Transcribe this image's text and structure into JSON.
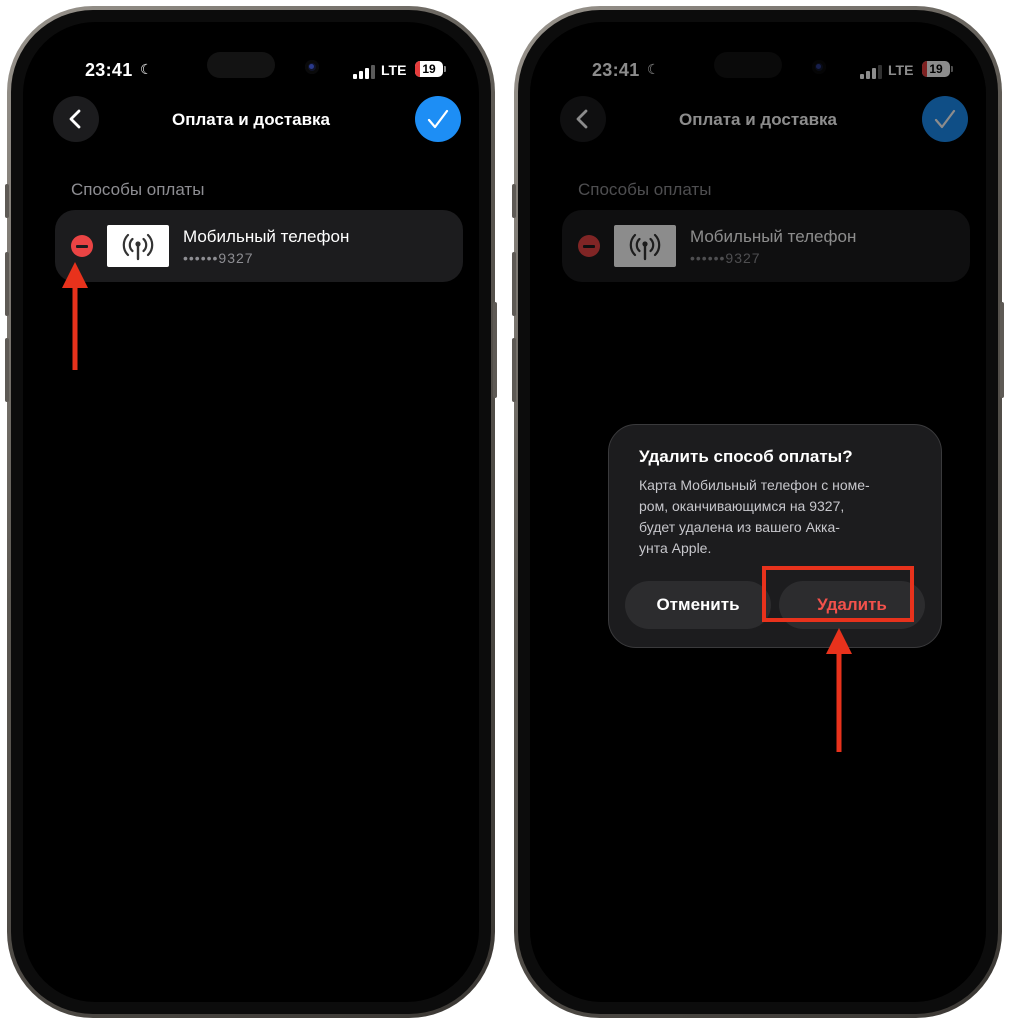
{
  "accent_color": "#1d8ef5",
  "destructive_color": "#f2514b",
  "annotation_color": "#e8321c",
  "status_bar": {
    "time": "23:41",
    "network": "LTE",
    "battery": "19",
    "battery_level": 0.19,
    "focus_icon": "moon-icon"
  },
  "nav": {
    "title": "Оплата и доставка",
    "back_icon": "chevron-left-icon",
    "done_icon": "checkmark-icon"
  },
  "payment_section": {
    "label": "Способы оплаты",
    "item": {
      "title": "Мобильный телефон",
      "number": "••••••9327",
      "icon": "antenna-icon"
    }
  },
  "alert": {
    "title": "Удалить способ оплаты?",
    "message": "Карта Мобильный телефон с номе-\nром, оканчивающимся на 9327,\nбудет удалена из вашего Акка-\nунта Apple.",
    "cancel": "Отменить",
    "delete": "Удалить"
  }
}
